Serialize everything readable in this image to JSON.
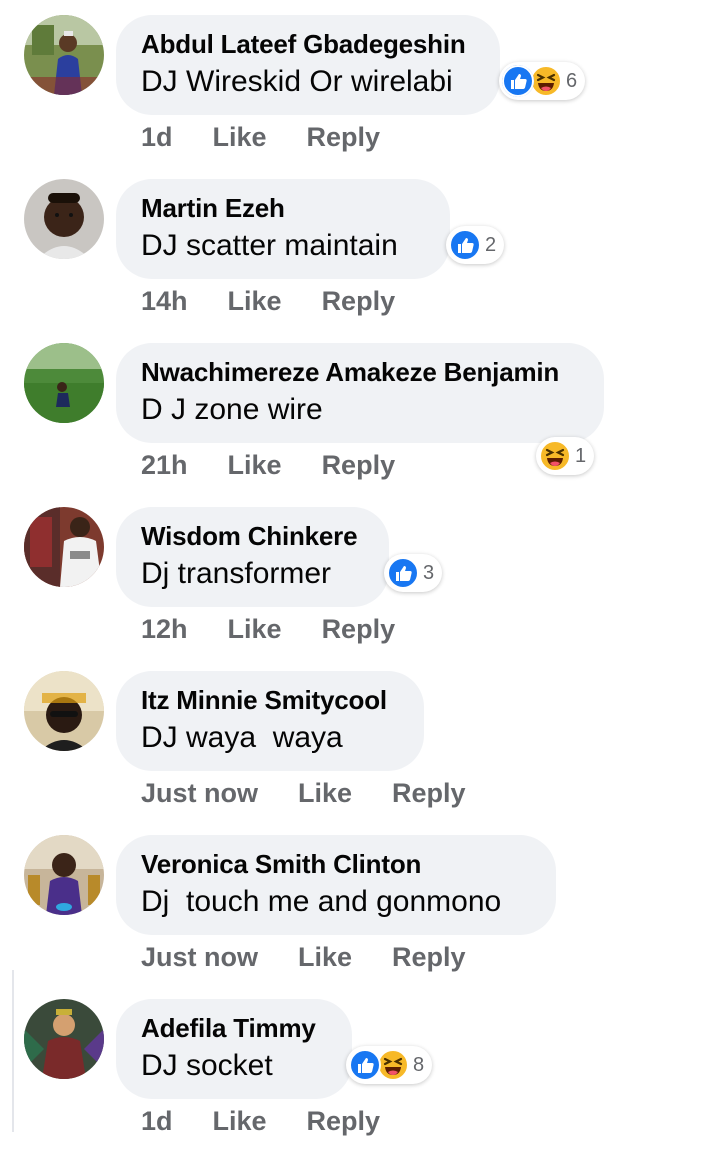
{
  "colors": {
    "bubble": "#f0f2f5",
    "meta_text": "#65676b",
    "like_blue": "#1877f2",
    "haha_yellow": "#f7b928"
  },
  "comments": [
    {
      "author": "Abdul Lateef Gbadegeshin",
      "text": "DJ Wireskid Or wirelabi",
      "time": "1d",
      "like": "Like",
      "reply": "Reply",
      "reactions": [
        "like-icon",
        "haha-icon"
      ],
      "reaction_count": "6"
    },
    {
      "author": "Martin Ezeh",
      "text": "DJ scatter maintain",
      "time": "14h",
      "like": "Like",
      "reply": "Reply",
      "reactions": [
        "like-icon"
      ],
      "reaction_count": "2"
    },
    {
      "author": "Nwachimereze Amakeze Benjamin",
      "text": "D J zone wire",
      "time": "21h",
      "like": "Like",
      "reply": "Reply",
      "reactions": [
        "haha-icon"
      ],
      "reaction_count": "1"
    },
    {
      "author": "Wisdom Chinkere",
      "text": "Dj transformer",
      "time": "12h",
      "like": "Like",
      "reply": "Reply",
      "reactions": [
        "like-icon"
      ],
      "reaction_count": "3"
    },
    {
      "author": "Itz Minnie Smitycool",
      "text": "DJ waya  waya",
      "time": "Just now",
      "like": "Like",
      "reply": "Reply",
      "reactions": [],
      "reaction_count": ""
    },
    {
      "author": "Veronica Smith Clinton",
      "text": "Dj  touch me and gonmono",
      "time": "Just now",
      "like": "Like",
      "reply": "Reply",
      "reactions": [],
      "reaction_count": ""
    },
    {
      "author": "Adefila Timmy",
      "text": "DJ socket",
      "time": "1d",
      "like": "Like",
      "reply": "Reply",
      "reactions": [
        "like-icon",
        "haha-icon"
      ],
      "reaction_count": "8"
    }
  ]
}
